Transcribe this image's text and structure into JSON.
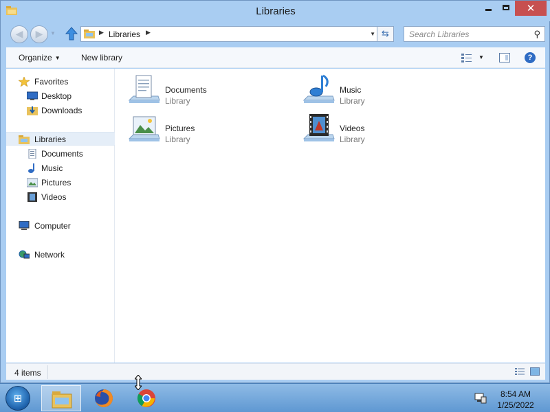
{
  "window": {
    "title": "Libraries",
    "controls": {
      "minimize": "minimize",
      "maximize": "maximize",
      "close": "✕"
    }
  },
  "navbar": {
    "breadcrumb": [
      "Libraries"
    ],
    "search_placeholder": "Search Libraries"
  },
  "commandbar": {
    "organize_label": "Organize",
    "new_library_label": "New library"
  },
  "navpane": {
    "favorites": {
      "label": "Favorites",
      "icon": "star-icon"
    },
    "favorites_items": [
      {
        "label": "Desktop",
        "icon": "desktop-icon"
      },
      {
        "label": "Downloads",
        "icon": "downloads-icon"
      }
    ],
    "libraries": {
      "label": "Libraries",
      "icon": "libraries-icon"
    },
    "libraries_items": [
      {
        "label": "Documents",
        "icon": "documents-icon"
      },
      {
        "label": "Music",
        "icon": "music-icon"
      },
      {
        "label": "Pictures",
        "icon": "pictures-icon"
      },
      {
        "label": "Videos",
        "icon": "videos-icon"
      }
    ],
    "computer": {
      "label": "Computer",
      "icon": "computer-icon"
    },
    "network": {
      "label": "Network",
      "icon": "network-icon"
    }
  },
  "main": {
    "items": [
      {
        "name": "Documents",
        "type": "Library",
        "icon": "documents-library-icon"
      },
      {
        "name": "Music",
        "type": "Library",
        "icon": "music-library-icon"
      },
      {
        "name": "Pictures",
        "type": "Library",
        "icon": "pictures-library-icon"
      },
      {
        "name": "Videos",
        "type": "Library",
        "icon": "videos-library-icon"
      }
    ]
  },
  "statusbar": {
    "text": "4 items"
  },
  "taskbar": {
    "apps": [
      "File Explorer",
      "Firefox",
      "Chrome"
    ],
    "clock": {
      "time": "8:54 AM",
      "date": "1/25/2022"
    }
  },
  "colors": {
    "frame": "#a9cdf2",
    "close_button": "#c75050",
    "selection": "#e5eef8",
    "taskbar": "#6aa0d8"
  }
}
